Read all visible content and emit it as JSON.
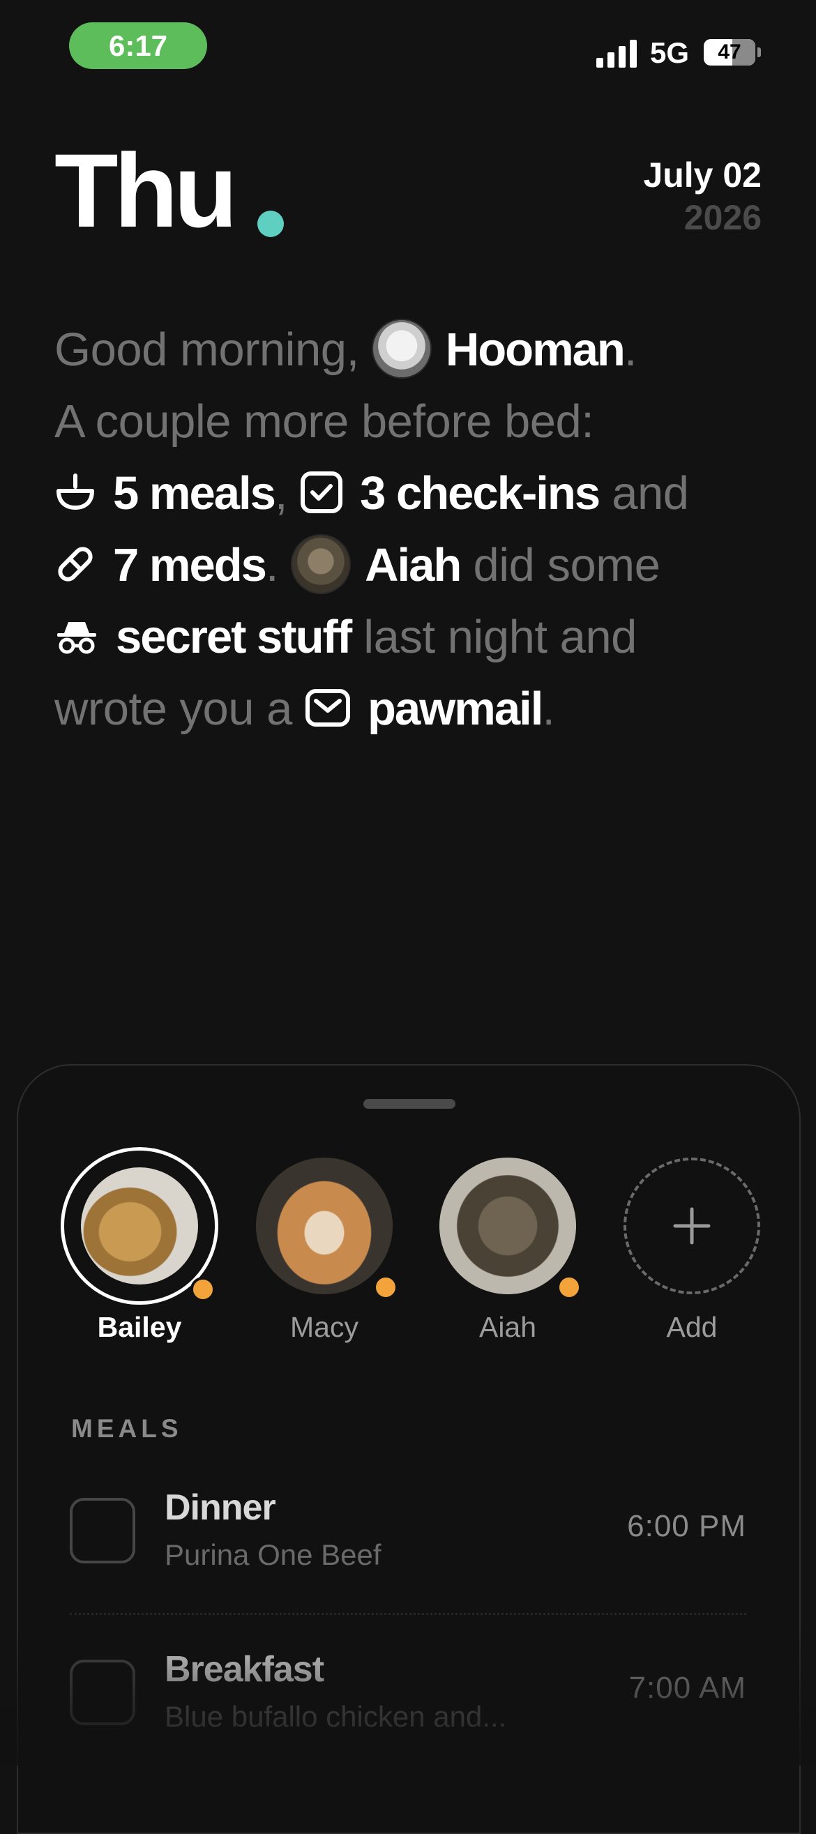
{
  "status_bar": {
    "time": "6:17",
    "network": "5G",
    "battery": "47",
    "battery_level": 0.47,
    "time_pill_color": "#5cbd5a"
  },
  "header": {
    "day": "Thu",
    "month_day": "July 02",
    "year": "2026",
    "accent_color": "#5ecfc1"
  },
  "greeting": {
    "line1_prefix": "Good morning,",
    "user_name": "Hooman",
    "line2": "A couple more before bed:",
    "meals": "5 meals",
    "checkins": "3 check-ins",
    "and_1": "and",
    "meds": "7 meds",
    "pet_name": "Aiah",
    "did_some": "did some",
    "secret": "secret stuff",
    "last_night": "last night and",
    "wrote": "wrote you a",
    "pawmail": "pawmail",
    "comma": ",",
    "period": "."
  },
  "pets": [
    {
      "name": "Bailey",
      "selected": true,
      "status_color": "#f2a43a"
    },
    {
      "name": "Macy",
      "selected": false,
      "status_color": "#f2a43a"
    },
    {
      "name": "Aiah",
      "selected": false,
      "status_color": "#f2a43a"
    }
  ],
  "add_label": "Add",
  "meals_section": {
    "label": "MEALS",
    "items": [
      {
        "title": "Dinner",
        "subtitle": "Purina One Beef",
        "time": "6:00 PM"
      },
      {
        "title": "Breakfast",
        "subtitle": "Blue bufallo chicken and...",
        "time": "7:00 AM"
      }
    ]
  }
}
